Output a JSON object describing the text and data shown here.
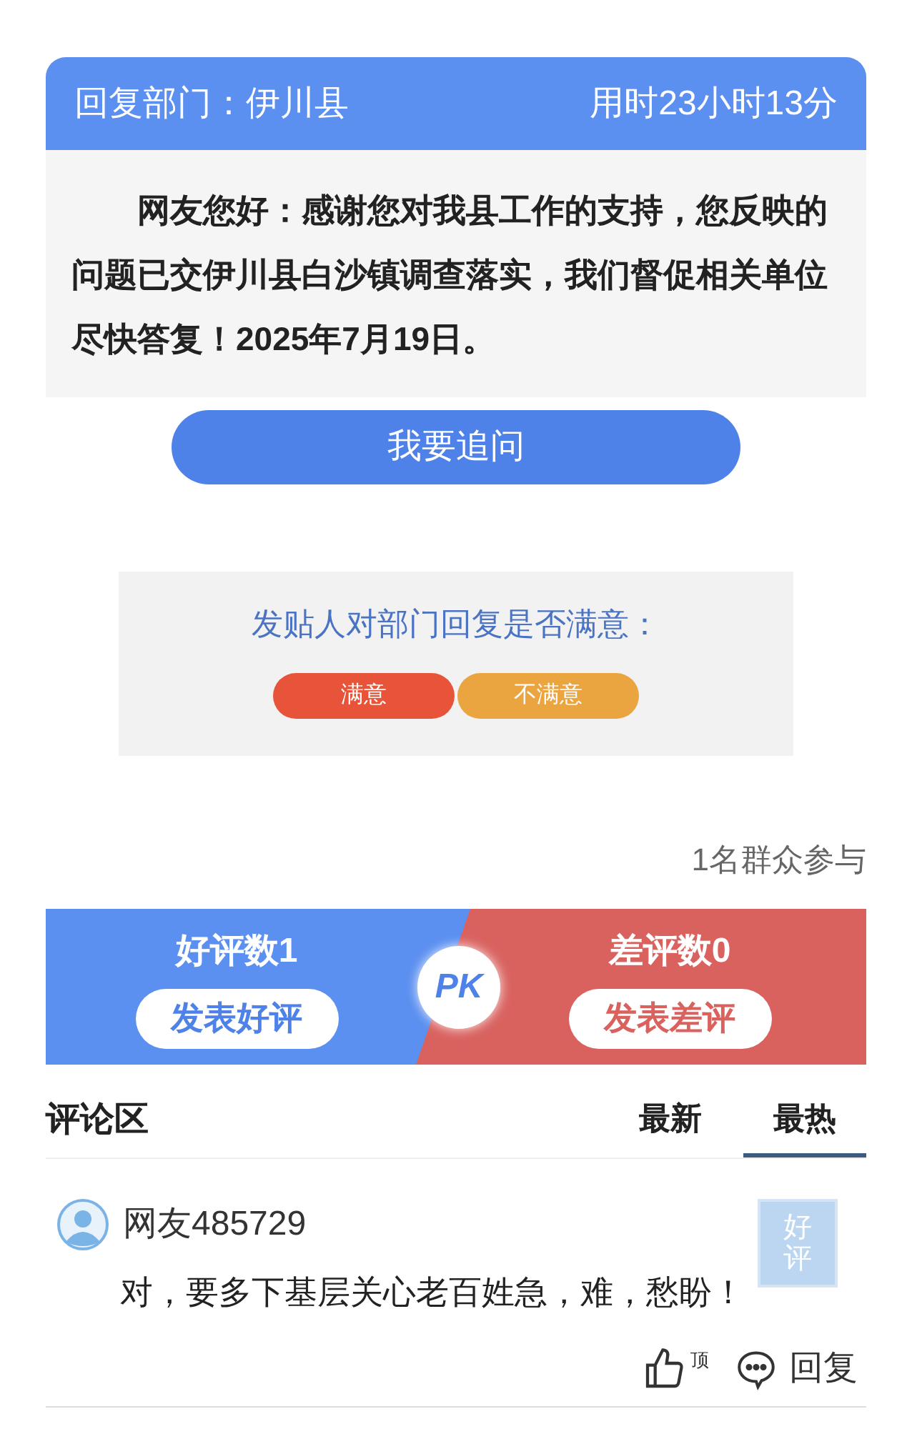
{
  "reply": {
    "department_label": "回复部门：伊川县",
    "duration": "用时23小时13分",
    "body": "网友您好：感谢您对我县工作的支持，您反映的问题已交伊川县白沙镇调查落实，我们督促相关单位尽快答复！2025年7月19日。",
    "follow_up_button": "我要追问"
  },
  "satisfaction": {
    "question": "发贴人对部门回复是否满意：",
    "options": [
      {
        "label": "满意",
        "kind": "positive"
      },
      {
        "label": "不满意",
        "kind": "negative"
      }
    ]
  },
  "participants": "1名群众参与",
  "pk": {
    "good_count": "好评数1",
    "good_button": "发表好评",
    "badge": "PK",
    "bad_count": "差评数0",
    "bad_button": "发表差评"
  },
  "comments_section": {
    "title": "评论区",
    "tabs": [
      {
        "label": "最新",
        "selected": false
      },
      {
        "label": "最热",
        "selected": true
      }
    ]
  },
  "comments": [
    {
      "user": "网友485729",
      "text": "对，要多下基层关心老百姓急，难，愁盼！",
      "stamp": "好评",
      "like_label": "顶",
      "reply_label": "回复"
    }
  ]
}
